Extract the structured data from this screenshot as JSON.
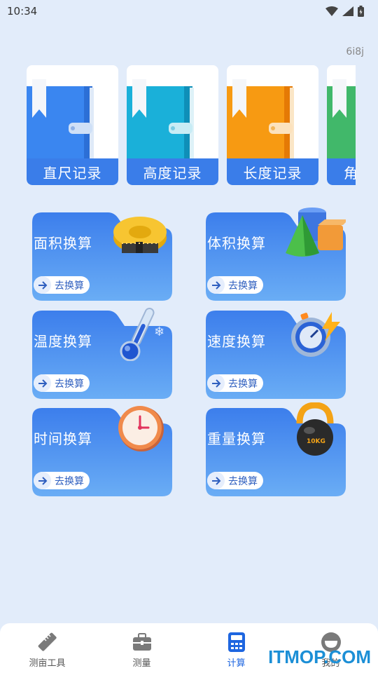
{
  "status_bar": {
    "time": "10:34"
  },
  "corner_tag": "6i8j",
  "record_cards": [
    {
      "label": "直尺记录",
      "color": "#3a86f0",
      "spine": "#2c6fd6"
    },
    {
      "label": "高度记录",
      "color": "#1ab0d9",
      "spine": "#0f8fb8"
    },
    {
      "label": "长度记录",
      "color": "#f79a12",
      "spine": "#e57a05"
    },
    {
      "label": "角",
      "color": "#41b86a",
      "spine": "#2e9a52"
    }
  ],
  "conversions": [
    {
      "title": "面积换算",
      "go": "去换算",
      "icon": "tape-measure-icon"
    },
    {
      "title": "体积换算",
      "go": "去换算",
      "icon": "3d-shapes-icon"
    },
    {
      "title": "温度换算",
      "go": "去换算",
      "icon": "thermometer-icon"
    },
    {
      "title": "速度换算",
      "go": "去换算",
      "icon": "stopwatch-icon"
    },
    {
      "title": "时间换算",
      "go": "去换算",
      "icon": "clock-icon"
    },
    {
      "title": "重量换算",
      "go": "去换算",
      "icon": "kettlebell-icon"
    }
  ],
  "kettlebell_text": "10KG",
  "nav": [
    {
      "label": "测亩工具",
      "icon": "ruler-icon",
      "active": false
    },
    {
      "label": "测量",
      "icon": "toolbox-icon",
      "active": false
    },
    {
      "label": "计算",
      "icon": "calculator-icon",
      "active": true
    },
    {
      "label": "我的",
      "icon": "profile-icon",
      "active": false
    }
  ],
  "watermark": "ITMOP.COM",
  "colors": {
    "accent": "#3a7de9",
    "card_top": "#4386ee",
    "card_bottom": "#6aadf5",
    "background": "#e2ecfa"
  }
}
